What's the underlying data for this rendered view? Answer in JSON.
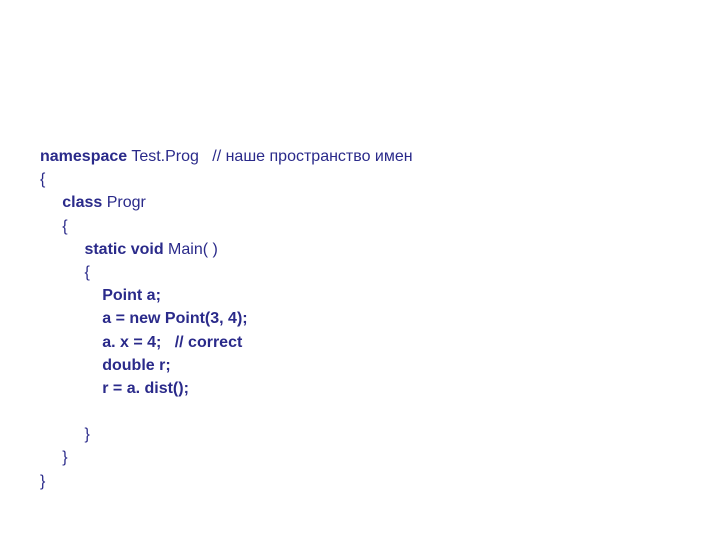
{
  "code": {
    "l1a": "namespace",
    "l1b": " Test.Prog   // наше пространство имен",
    "l2": "{",
    "l3a": "     class",
    "l3b": " Progr",
    "l4": "     {",
    "l5a": "          static void",
    "l5b": " Main( )",
    "l6": "          {",
    "l7": "              Point a;",
    "l8": "              a = new Point(3, 4);",
    "l9": "              a. x = 4;   // correct",
    "l10": "              double r;",
    "l11": "              r = a. dist();",
    "blank": "",
    "l12": "          }",
    "l13": "     }",
    "l14": "}"
  }
}
